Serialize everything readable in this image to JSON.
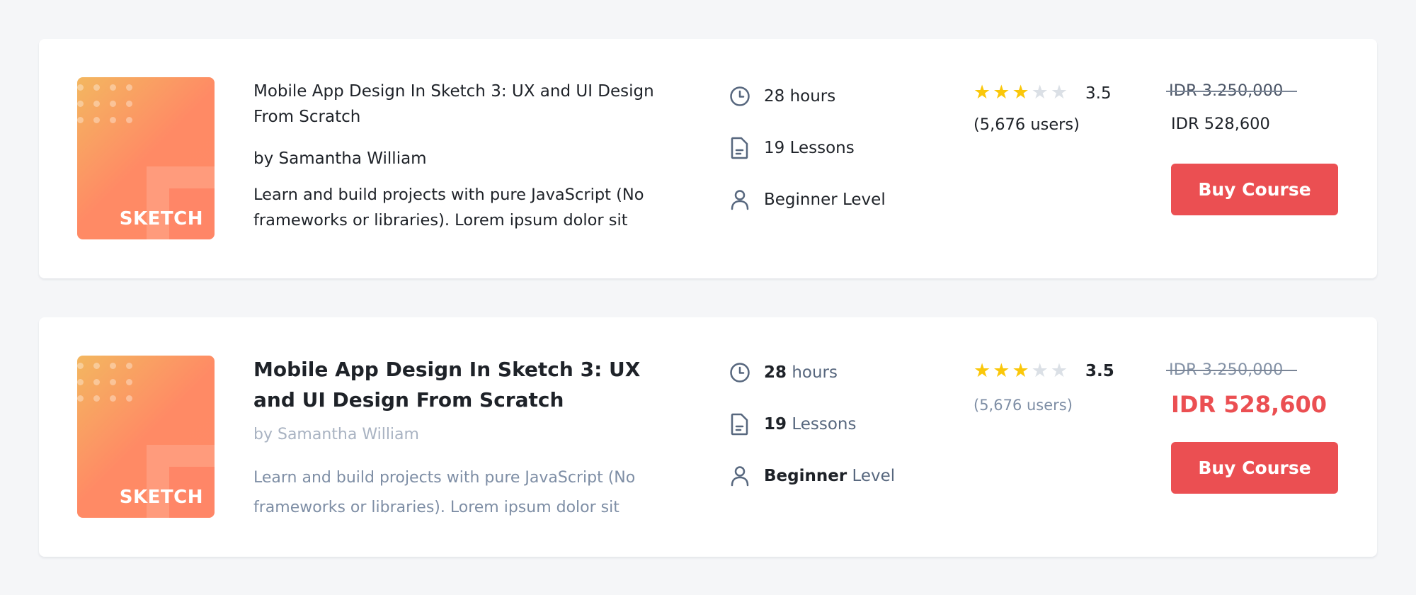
{
  "courses": [
    {
      "thumbnail_label": "SKETCH",
      "title": "Mobile App Design In Sketch 3: UX and UI Design From Scratch",
      "author": "by Samantha William",
      "description": "Learn and build projects with pure JavaScript (No frameworks or libraries). Lorem ipsum dolor sit",
      "duration": "28 hours",
      "lessons": "19 Lessons",
      "level": "Beginner Level",
      "rating_stars": 3,
      "rating": "3.5",
      "users": "(5,676 users)",
      "old_price": "IDR 3.250,000",
      "price": "IDR 528,600",
      "buy_label": "Buy Course"
    },
    {
      "thumbnail_label": "SKETCH",
      "title": "Mobile App Design In Sketch 3: UX and UI Design From Scratch",
      "author": "by Samantha William",
      "description": "Learn and build projects with pure JavaScript (No frameworks or libraries). Lorem ipsum dolor sit",
      "duration_num": "28",
      "duration_unit": "hours",
      "lessons_num": "19",
      "lessons_unit": "Lessons",
      "level_num": "Beginner",
      "level_unit": "Level",
      "rating_stars": 3,
      "rating": "3.5",
      "users": "(5,676 users)",
      "old_price": "IDR 3.250,000",
      "price": "IDR 528,600",
      "buy_label": "Buy Course"
    }
  ],
  "colors": {
    "background": "#f5f6f8",
    "card": "#ffffff",
    "accent": "#eb4f52",
    "star_on": "#fac70a",
    "star_off": "#dbe0e6",
    "icon": "#57677e"
  },
  "icons": [
    "clock-icon",
    "document-icon",
    "user-icon",
    "star-icon"
  ]
}
